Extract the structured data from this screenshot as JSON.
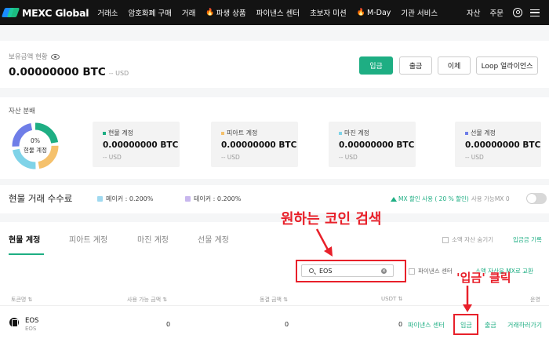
{
  "nav": {
    "logo": "MEXC Global",
    "items": [
      "거래소",
      "암호화폐 구매",
      "거래",
      "파생 상품",
      "파이낸스 센터",
      "초보자 미션",
      "M-Day",
      "기관 서비스"
    ],
    "right": [
      "자산",
      "주문"
    ]
  },
  "balance": {
    "label": "보유금액 현황",
    "amount": "0.00000000 BTC",
    "usd": "-- USD",
    "buttons": {
      "deposit": "입금",
      "withdraw": "출금",
      "transfer": "이체",
      "loop": "Loop 얼라이언스"
    }
  },
  "distribution": {
    "label": "자산 분배",
    "donut_percent": "0%",
    "donut_caption": "현물 계정",
    "donut_colors": [
      "#1eae83",
      "#f5c16c",
      "#7fd3e8",
      "#6f7ee8"
    ],
    "accounts": [
      {
        "title": "현물 계정",
        "value": "0.00000000 BTC",
        "usd": "-- USD",
        "color": "#1eae83"
      },
      {
        "title": "피아트 계정",
        "value": "0.00000000 BTC",
        "usd": "-- USD",
        "color": "#f5c16c"
      },
      {
        "title": "마진 계정",
        "value": "0.00000000 BTC",
        "usd": "-- USD",
        "color": "#7fd3e8"
      },
      {
        "title": "선물 계정",
        "value": "0.00000000 BTC",
        "usd": "-- USD",
        "color": "#6f7ee8"
      }
    ]
  },
  "fee": {
    "title": "현물 거래 수수료",
    "maker": "메이커 : 0.200%",
    "taker": "테이커 : 0.200%",
    "mx_discount": "MX 할인 사용 ( 20 % 할인)",
    "mx_available": "사용 가능MX 0"
  },
  "tabs": [
    "현물 계정",
    "피아트 계정",
    "마진 계정",
    "선물 계정"
  ],
  "hide_small": "소액 자산 숨기기",
  "deposit_history": "입금금 기록",
  "search": {
    "value": "EOS"
  },
  "funding_center": "파이낸스 센터",
  "mx_convert": "소액 자산을 MX로 교환",
  "table": {
    "headers": [
      "토큰명",
      "사용 가능 금액",
      "동결 금액",
      "USDT",
      "운영"
    ],
    "row": {
      "coin": "EOS",
      "sub": "EOS",
      "available": "0",
      "frozen": "0",
      "usdt": "0",
      "actions": [
        "파이낸스 센터",
        "입금",
        "출금",
        "거래하러가기"
      ]
    }
  },
  "annotations": {
    "search_hint": "원하는 코인 검색",
    "deposit_hint": "'입금' 클릭"
  }
}
